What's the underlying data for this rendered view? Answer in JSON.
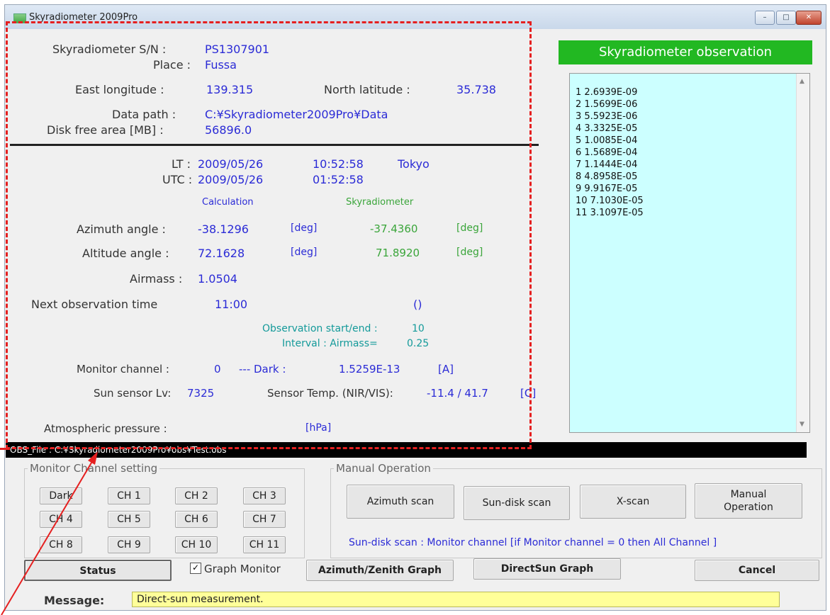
{
  "window": {
    "title": "Skyradiometer 2009Pro",
    "min_glyph": "–",
    "max_glyph": "□",
    "close_glyph": "✕"
  },
  "info": {
    "sn_label": "Skyradiometer S/N :",
    "sn_value": "PS1307901",
    "place_label": "Place :",
    "place_value": "Fussa",
    "lon_label": "East  longitude :",
    "lon_value": "139.315",
    "lat_label": "North   latitude :",
    "lat_value": "35.738",
    "path_label": "Data path :",
    "path_value": "C:¥Skyradiometer2009Pro¥Data",
    "disk_label": "Disk free area [MB] :",
    "disk_value": "56896.0"
  },
  "time": {
    "lt_label": "LT :",
    "lt_date": "2009/05/26",
    "lt_time": "10:52:58",
    "lt_zone": "Tokyo",
    "utc_label": "UTC :",
    "utc_date": "2009/05/26",
    "utc_time": "01:52:58"
  },
  "angles": {
    "calc_header": "Calculation",
    "sky_header": "Skyradiometer",
    "azimuth_label": "Azimuth angle :",
    "azimuth_calc": "-38.1296",
    "azimuth_unit": "[deg]",
    "azimuth_sky": "-37.4360",
    "azimuth_sky_unit": "[deg]",
    "altitude_label": "Altitude angle :",
    "altitude_calc": "72.1628",
    "altitude_unit": "[deg]",
    "altitude_sky": "71.8920",
    "altitude_sky_unit": "[deg]",
    "airmass_label": "Airmass :",
    "airmass_value": "1.0504"
  },
  "schedule": {
    "next_label": "Next observation time",
    "next_value": "11:00",
    "next_paren": "()",
    "startend_label": "Observation start/end :",
    "startend_value": "10",
    "interval_label": "Interval : Airmass=",
    "interval_value": "0.25"
  },
  "monitor": {
    "channel_label": "Monitor channel :",
    "channel_value": "0",
    "dark_label": "---  Dark :",
    "dark_value": "1.5259E-13",
    "dark_unit": "[A]",
    "sun_label": "Sun sensor Lv:",
    "sun_value": "7325",
    "temp_label": "Sensor Temp. (NIR/VIS):",
    "temp_value": "-11.4 / 41.7",
    "temp_unit": "[C]",
    "pressure_label": "Atmospheric pressure :",
    "pressure_unit": "[hPa]"
  },
  "observation": {
    "title": "Skyradiometer observation",
    "items": [
      "1  2.6939E-09",
      "2  1.5699E-06",
      "3  5.5923E-06",
      "4  3.3325E-05",
      "5  1.0085E-04",
      "6  1.5689E-04",
      "7  1.1444E-04",
      "8  4.8958E-05",
      "9  9.9167E-05",
      "10  7.1030E-05",
      "11  3.1097E-05"
    ]
  },
  "status_bar": "OBS_File : C:¥Skyradiometer2009Pro¥obs¥Test.obs",
  "monitor_setting": {
    "legend": "Monitor Channel setting",
    "buttons": [
      "Dark",
      "CH 1",
      "CH 2",
      "CH 3",
      "CH 4",
      "CH 5",
      "CH 6",
      "CH 7",
      "CH 8",
      "CH 9",
      "CH 10",
      "CH 11"
    ]
  },
  "manual": {
    "legend": "Manual Operation",
    "azimuth_scan": "Azimuth scan",
    "sundisk_scan": "Sun-disk scan",
    "x_scan": "X-scan",
    "manual_line1": "Manual",
    "manual_line2": "Operation",
    "note": "Sun-disk scan : Monitor channel [if  Monitor channel = 0 then All Channel ]"
  },
  "bottom": {
    "status": "Status",
    "graph_monitor": "Graph Monitor",
    "graph_checked": "✓",
    "azimuth_graph": "Azimuth/Zenith Graph",
    "directsun_graph": "DirectSun Graph",
    "cancel": "Cancel"
  },
  "message": {
    "label": "Message:",
    "text": "Direct-sun measurement."
  }
}
